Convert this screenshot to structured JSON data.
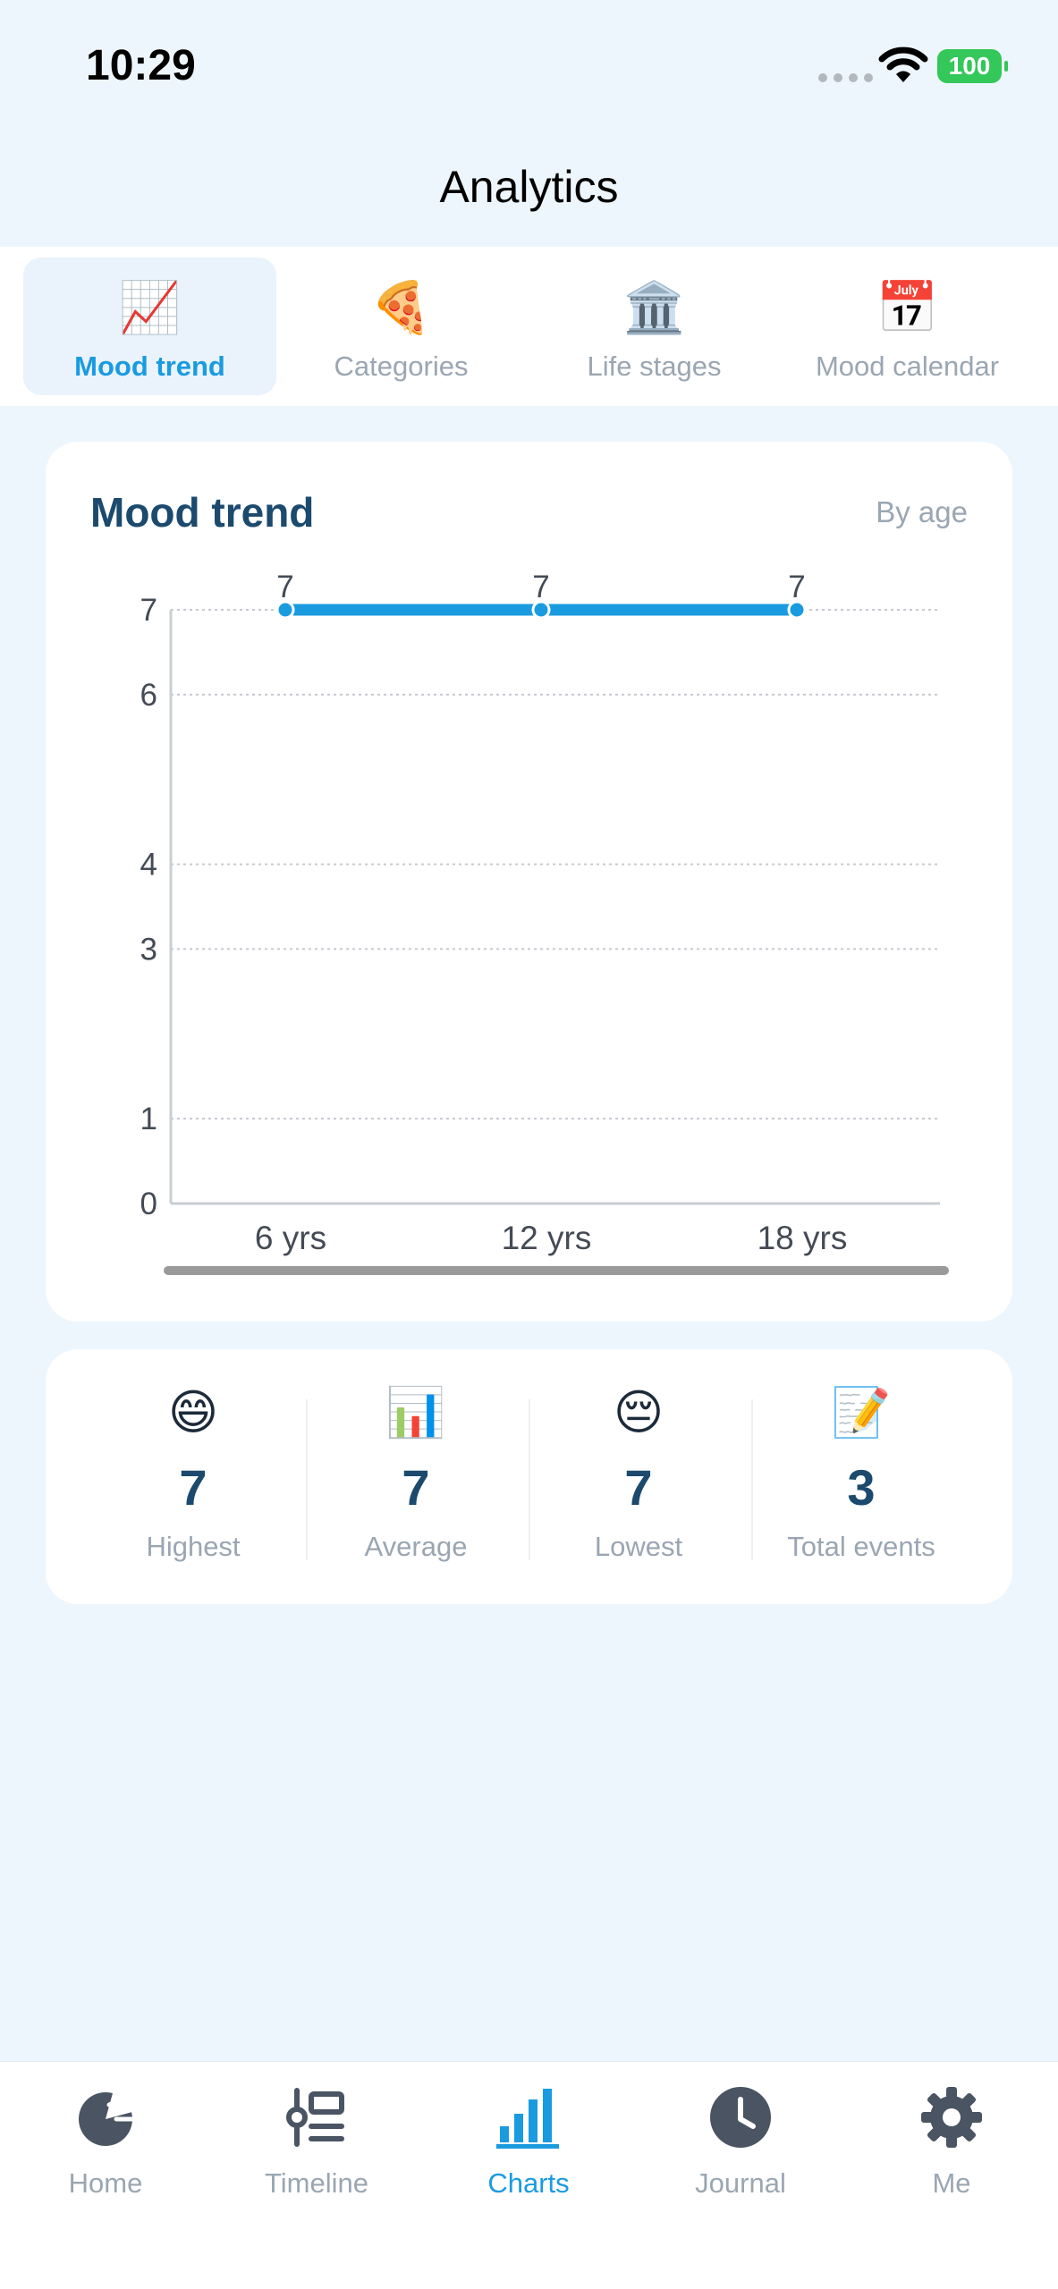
{
  "status_bar": {
    "time": "10:29",
    "battery": "100"
  },
  "header": {
    "title": "Analytics"
  },
  "tabs": [
    {
      "emoji": "📈",
      "label": "Mood trend",
      "active": true
    },
    {
      "emoji": "🍕",
      "label": "Categories",
      "active": false
    },
    {
      "emoji": "🏛️",
      "label": "Life stages",
      "active": false
    },
    {
      "emoji": "📅",
      "label": "Mood calendar",
      "active": false
    }
  ],
  "chart_card": {
    "title": "Mood trend",
    "subtitle": "By age"
  },
  "chart_data": {
    "type": "line",
    "title": "Mood trend",
    "subtitle": "By age",
    "categories": [
      "6 yrs",
      "12 yrs",
      "18 yrs"
    ],
    "series": [
      {
        "values": [
          7,
          7,
          7
        ],
        "color": "#1a9be0"
      }
    ],
    "data_labels": [
      "7",
      "7",
      "7"
    ],
    "y_ticks": [
      0,
      1,
      3,
      4,
      6,
      7
    ],
    "ylim": [
      0,
      7
    ],
    "grid": true,
    "xlabel": "",
    "ylabel": ""
  },
  "stats": [
    {
      "emoji": "😄",
      "value": "7",
      "label": "Highest"
    },
    {
      "emoji": "📊",
      "value": "7",
      "label": "Average"
    },
    {
      "emoji": "😔",
      "value": "7",
      "label": "Lowest"
    },
    {
      "emoji": "📝",
      "value": "3",
      "label": "Total events"
    }
  ],
  "bottom_nav": [
    {
      "icon": "home-pie-icon",
      "label": "Home",
      "active": false
    },
    {
      "icon": "timeline-icon",
      "label": "Timeline",
      "active": false
    },
    {
      "icon": "bar-chart-icon",
      "label": "Charts",
      "active": true
    },
    {
      "icon": "clock-icon",
      "label": "Journal",
      "active": false
    },
    {
      "icon": "gear-icon",
      "label": "Me",
      "active": false
    }
  ],
  "colors": {
    "accent": "#1a9be0",
    "title": "#1b4a6e",
    "muted": "#9aa6b2",
    "background": "#eef6fd"
  }
}
